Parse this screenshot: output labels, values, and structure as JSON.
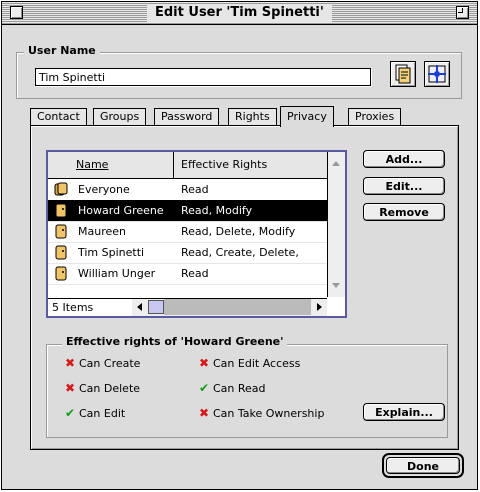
{
  "window": {
    "title": "Edit User 'Tim Spinetti'"
  },
  "user_name": {
    "label": "User Name",
    "value": "Tim Spinetti"
  },
  "tabs": [
    {
      "label": "Contact"
    },
    {
      "label": "Groups"
    },
    {
      "label": "Password"
    },
    {
      "label": "Rights"
    },
    {
      "label": "Privacy"
    },
    {
      "label": "Proxies"
    }
  ],
  "active_tab": "Privacy",
  "list": {
    "columns": [
      "Name",
      "Effective Rights"
    ],
    "rows": [
      {
        "name": "Everyone",
        "rights": "Read",
        "icon": "group-icon"
      },
      {
        "name": "Howard Greene",
        "rights": "Read, Modify",
        "icon": "user-icon"
      },
      {
        "name": "Maureen",
        "rights": "Read, Delete, Modify",
        "icon": "user-icon"
      },
      {
        "name": "Tim Spinetti",
        "rights": "Read, Create, Delete,",
        "icon": "user-icon"
      },
      {
        "name": "William Unger",
        "rights": "Read",
        "icon": "user-icon"
      }
    ],
    "selected_row": "Howard Greene",
    "items_count": "5 Items"
  },
  "buttons": {
    "add": "Add...",
    "edit": "Edit...",
    "remove": "Remove",
    "explain": "Explain...",
    "done": "Done"
  },
  "effective_rights": {
    "title": "Effective rights of 'Howard Greene'",
    "items": [
      {
        "label": "Can Create",
        "granted": false
      },
      {
        "label": "Can Edit Access",
        "granted": false
      },
      {
        "label": "Can Delete",
        "granted": false
      },
      {
        "label": "Can Read",
        "granted": true
      },
      {
        "label": "Can Edit",
        "granted": true
      },
      {
        "label": "Can Take Ownership",
        "granted": false
      }
    ]
  },
  "marks": {
    "granted": "✔",
    "denied": "✖"
  },
  "colors": {
    "granted": "#159a15",
    "denied": "#d61818",
    "selection": "#000000",
    "list_focus_border": "#5a5aa0"
  }
}
